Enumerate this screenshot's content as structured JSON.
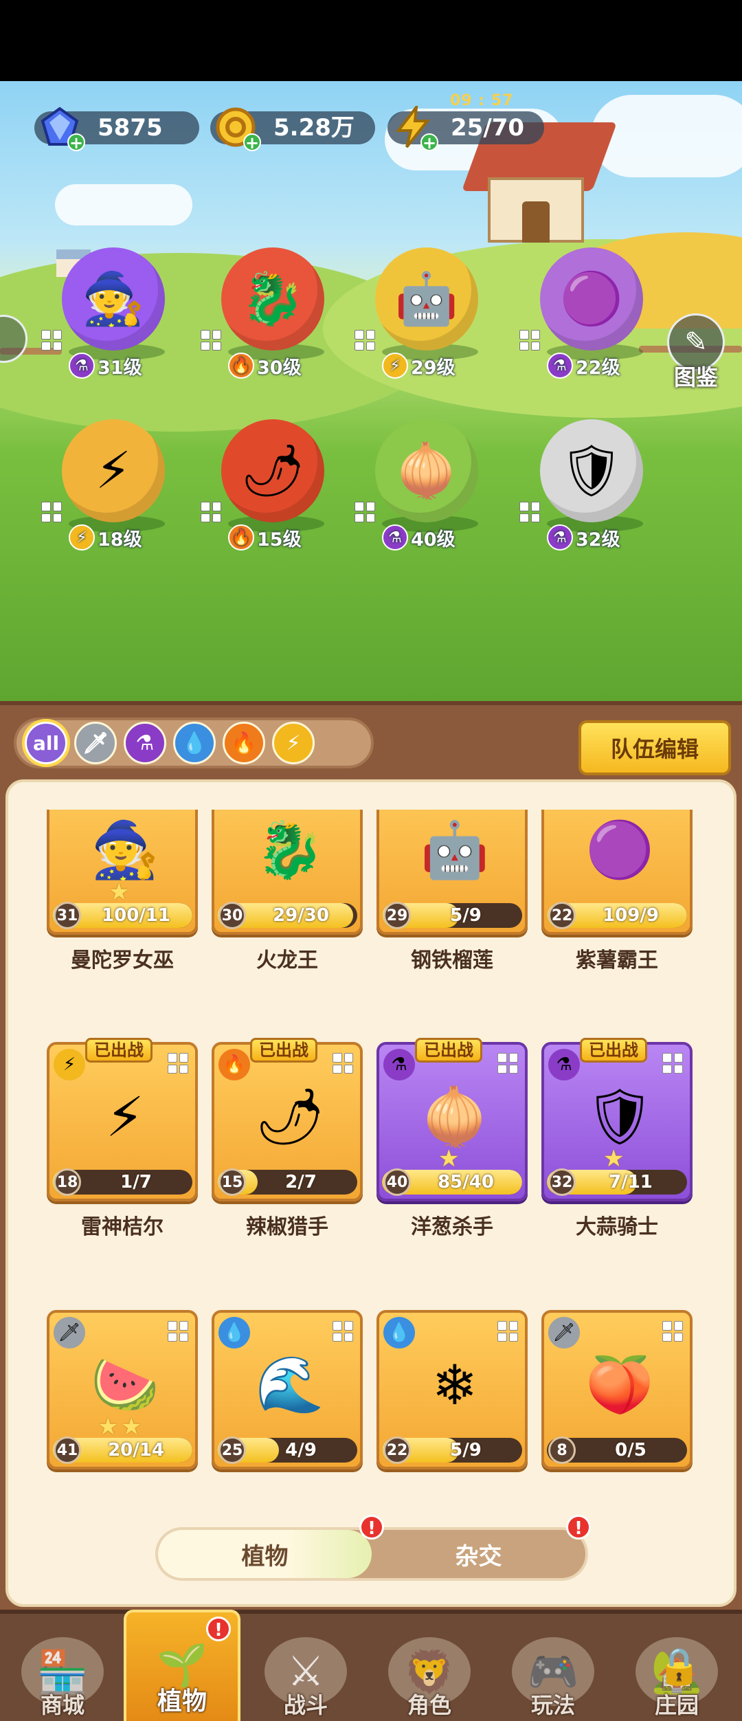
{
  "resources": {
    "gems": "5875",
    "gold": "5.28万",
    "energy": "25/70",
    "energy_timer": "09 : 57"
  },
  "codex_label": "图鉴",
  "field_plants": [
    {
      "level": "31级",
      "element": "purple",
      "emoji": "🧙",
      "color": "#9b5cf0"
    },
    {
      "level": "30级",
      "element": "fire",
      "emoji": "🐉",
      "color": "#e8553a"
    },
    {
      "level": "29级",
      "element": "bolt",
      "emoji": "🤖",
      "color": "#f0c43a"
    },
    {
      "level": "22级",
      "element": "purple",
      "emoji": "🟣",
      "color": "#b06fd9"
    },
    {
      "level": "18级",
      "element": "bolt",
      "emoji": "⚡",
      "color": "#f2b33a"
    },
    {
      "level": "15级",
      "element": "fire",
      "emoji": "🌶",
      "color": "#e04a2a"
    },
    {
      "level": "40级",
      "element": "purple",
      "emoji": "🧅",
      "color": "#8cc84a"
    },
    {
      "level": "32级",
      "element": "purple",
      "emoji": "🛡",
      "color": "#d9d9d9"
    }
  ],
  "filters": [
    "all",
    "sword",
    "purple",
    "water",
    "fire",
    "bolt"
  ],
  "team_edit_label": "队伍编辑",
  "deployed_label": "已出战",
  "cards": [
    {
      "name": "曼陀罗女巫",
      "level": "31",
      "progress": "100/11",
      "fill": 1.0,
      "purple": false,
      "emoji": "🧙",
      "deployed": false,
      "element": "",
      "stars": 1
    },
    {
      "name": "火龙王",
      "level": "30",
      "progress": "29/30",
      "fill": 0.97,
      "purple": false,
      "emoji": "🐉",
      "deployed": false,
      "element": "",
      "stars": 0
    },
    {
      "name": "钢铁榴莲",
      "level": "29",
      "progress": "5/9",
      "fill": 0.55,
      "purple": false,
      "emoji": "🤖",
      "deployed": false,
      "element": "",
      "stars": 0
    },
    {
      "name": "紫薯霸王",
      "level": "22",
      "progress": "109/9",
      "fill": 1.0,
      "purple": false,
      "emoji": "🟣",
      "deployed": false,
      "element": "",
      "stars": 0
    },
    {
      "name": "雷神桔尔",
      "level": "18",
      "progress": "1/7",
      "fill": 0.14,
      "purple": false,
      "emoji": "⚡",
      "deployed": true,
      "element": "bolt",
      "stars": 0
    },
    {
      "name": "辣椒猎手",
      "level": "15",
      "progress": "2/7",
      "fill": 0.29,
      "purple": false,
      "emoji": "🌶",
      "deployed": true,
      "element": "fire",
      "stars": 0
    },
    {
      "name": "洋葱杀手",
      "level": "40",
      "progress": "85/40",
      "fill": 1.0,
      "purple": true,
      "emoji": "🧅",
      "deployed": true,
      "element": "purple",
      "stars": 1
    },
    {
      "name": "大蒜骑士",
      "level": "32",
      "progress": "7/11",
      "fill": 0.64,
      "purple": true,
      "emoji": "🛡",
      "deployed": true,
      "element": "purple",
      "stars": 1
    },
    {
      "name": "",
      "level": "41",
      "progress": "20/14",
      "fill": 1.0,
      "purple": false,
      "emoji": "🍉",
      "deployed": false,
      "element": "sword",
      "stars": 2
    },
    {
      "name": "",
      "level": "25",
      "progress": "4/9",
      "fill": 0.44,
      "purple": false,
      "emoji": "🌊",
      "deployed": false,
      "element": "water",
      "stars": 0
    },
    {
      "name": "",
      "level": "22",
      "progress": "5/9",
      "fill": 0.55,
      "purple": false,
      "emoji": "❄",
      "deployed": false,
      "element": "water",
      "stars": 0
    },
    {
      "name": "",
      "level": "8",
      "progress": "0/5",
      "fill": 0.0,
      "purple": false,
      "emoji": "🍑",
      "deployed": false,
      "element": "sword",
      "stars": 0
    }
  ],
  "toggle": {
    "plants": "植物",
    "hybrid": "杂交"
  },
  "alert_mark": "!",
  "nav": [
    {
      "label": "商城",
      "icon": "🏪"
    },
    {
      "label": "植物",
      "icon": "🌱"
    },
    {
      "label": "战斗",
      "icon": "⚔"
    },
    {
      "label": "角色",
      "icon": "🦁"
    },
    {
      "label": "玩法",
      "icon": "🎮"
    },
    {
      "label": "庄园",
      "icon": "🏡"
    }
  ]
}
